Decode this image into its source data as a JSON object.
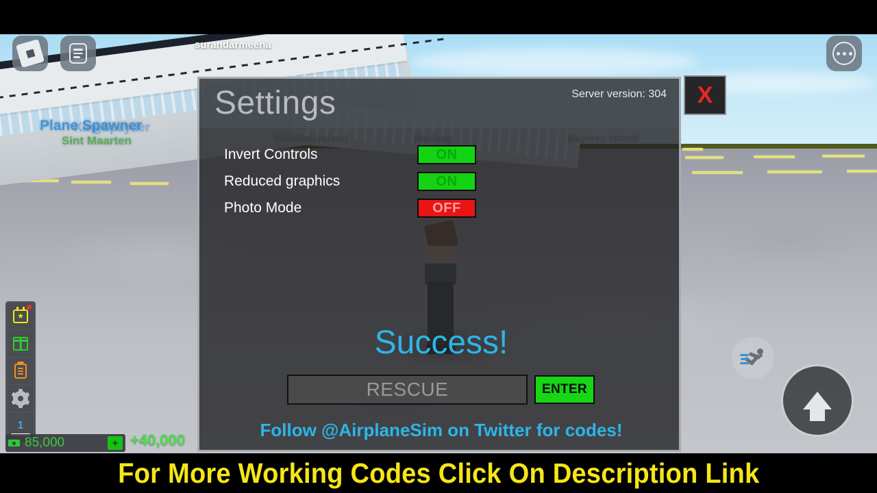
{
  "roblox_hud": {
    "username": "surandarmeena",
    "logo_icon": "roblox-logo-icon",
    "menu_icon": "chat-document-icon",
    "more_icon": "more-dots-icon"
  },
  "world": {
    "labels": [
      {
        "text": "Plane Spawner",
        "color": "#3e97e0"
      },
      {
        "text": "KingSpayder",
        "color": "#3e97e0"
      },
      {
        "text": "Sint Maarten",
        "color": "#5aaf5e"
      },
      {
        "text": "TOMBali Island",
        "color": "#8a8d92"
      },
      {
        "text": "Medang",
        "color": "#8a8d92"
      },
      {
        "text": "Mujeres Island",
        "color": "#8a8d92"
      }
    ]
  },
  "settings_panel": {
    "title": "Settings",
    "server_version_label": "Server version: 304",
    "close_label": "X",
    "rows": [
      {
        "label": "Invert Controls",
        "value": "ON",
        "state": "on"
      },
      {
        "label": "Reduced graphics",
        "value": "ON",
        "state": "on"
      },
      {
        "label": "Photo Mode",
        "value": "OFF",
        "state": "off"
      }
    ],
    "status_message": "Success!",
    "code_placeholder": "RESCUE",
    "enter_label": "ENTER",
    "follow_text": "Follow  @AirplaneSim  on Twitter for codes!"
  },
  "left_hud": {
    "items": [
      {
        "icon": "calendar-star-icon",
        "badge": true
      },
      {
        "icon": "package-box-icon",
        "badge": false
      },
      {
        "icon": "clipboard-icon",
        "badge": false
      },
      {
        "icon": "gear-icon",
        "badge": false
      },
      {
        "icon": "hotbar-slot-icon",
        "badge": false,
        "label": "1"
      }
    ]
  },
  "currency": {
    "amount": "85,000",
    "plus_label": "+",
    "gain": "+40,000",
    "cash_icon": "cash-icon"
  },
  "mobile_controls": {
    "sprint_icon": "sprint-run-icon",
    "jump_icon": "jump-arrow-up-icon"
  },
  "overlay_banner": {
    "text": "For More Working Codes Click On Description Link"
  },
  "colors": {
    "toggle_on": "#14d314",
    "toggle_off": "#ea1414",
    "accent_blue": "#2cb6e8",
    "banner_yellow": "#f5e617",
    "money_green": "#3ecb3e"
  }
}
